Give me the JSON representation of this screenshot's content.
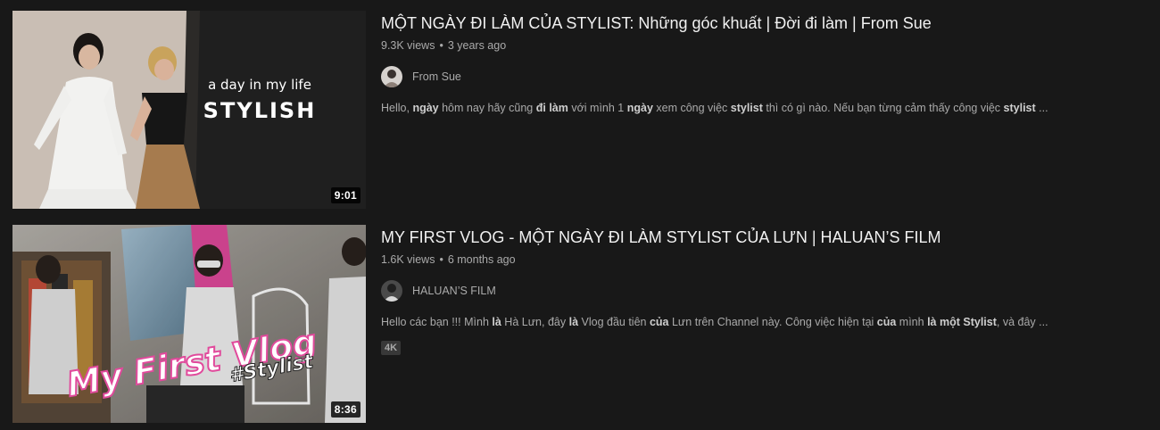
{
  "results": [
    {
      "title": "MỘT NGÀY ĐI LÀM CỦA STYLIST: Những góc khuất | Đời đi làm | From Sue",
      "views": "9.3K views",
      "separator": "•",
      "age": "3 years ago",
      "channel": "From Sue",
      "duration": "9:01",
      "thumbnail_text": {
        "line1": "a day in my life",
        "line2": "STYLISH"
      },
      "description": [
        {
          "t": "Hello, ",
          "b": false
        },
        {
          "t": "ngày",
          "b": true
        },
        {
          "t": " hôm nay hãy cũng ",
          "b": false
        },
        {
          "t": "đi làm",
          "b": true
        },
        {
          "t": " với mình 1 ",
          "b": false
        },
        {
          "t": "ngày",
          "b": true
        },
        {
          "t": " xem công việc ",
          "b": false
        },
        {
          "t": "stylist",
          "b": true
        },
        {
          "t": " thì có gì nào. Nếu bạn từng cảm thấy công việc ",
          "b": false
        },
        {
          "t": "stylist",
          "b": true
        },
        {
          "t": " ...",
          "b": false
        }
      ]
    },
    {
      "title": "MY FIRST VLOG - MỘT NGÀY ĐI LÀM STYLIST CỦA LƯN | HALUAN’S FILM",
      "views": "1.6K views",
      "separator": "•",
      "age": "6 months ago",
      "channel": "HALUAN’S FILM",
      "duration": "8:36",
      "badge": "4K",
      "thumbnail_text": {
        "line1": "My First Vlog",
        "line2": "#Stylist"
      },
      "description": [
        {
          "t": "Hello các bạn !!! Mình ",
          "b": false
        },
        {
          "t": "là",
          "b": true
        },
        {
          "t": " Hà Lưn, đây ",
          "b": false
        },
        {
          "t": "là",
          "b": true
        },
        {
          "t": " Vlog đầu tiên ",
          "b": false
        },
        {
          "t": "của",
          "b": true
        },
        {
          "t": " Lưn trên Channel này. Công việc hiện tại ",
          "b": false
        },
        {
          "t": "của",
          "b": true
        },
        {
          "t": " mình ",
          "b": false
        },
        {
          "t": "là một Stylist",
          "b": true
        },
        {
          "t": ", và đây ...",
          "b": false
        }
      ]
    }
  ],
  "colors": {
    "background": "#181818",
    "title": "#f1f1f1",
    "secondary_text": "#aaaaaa",
    "badge_bg": "#383838"
  }
}
